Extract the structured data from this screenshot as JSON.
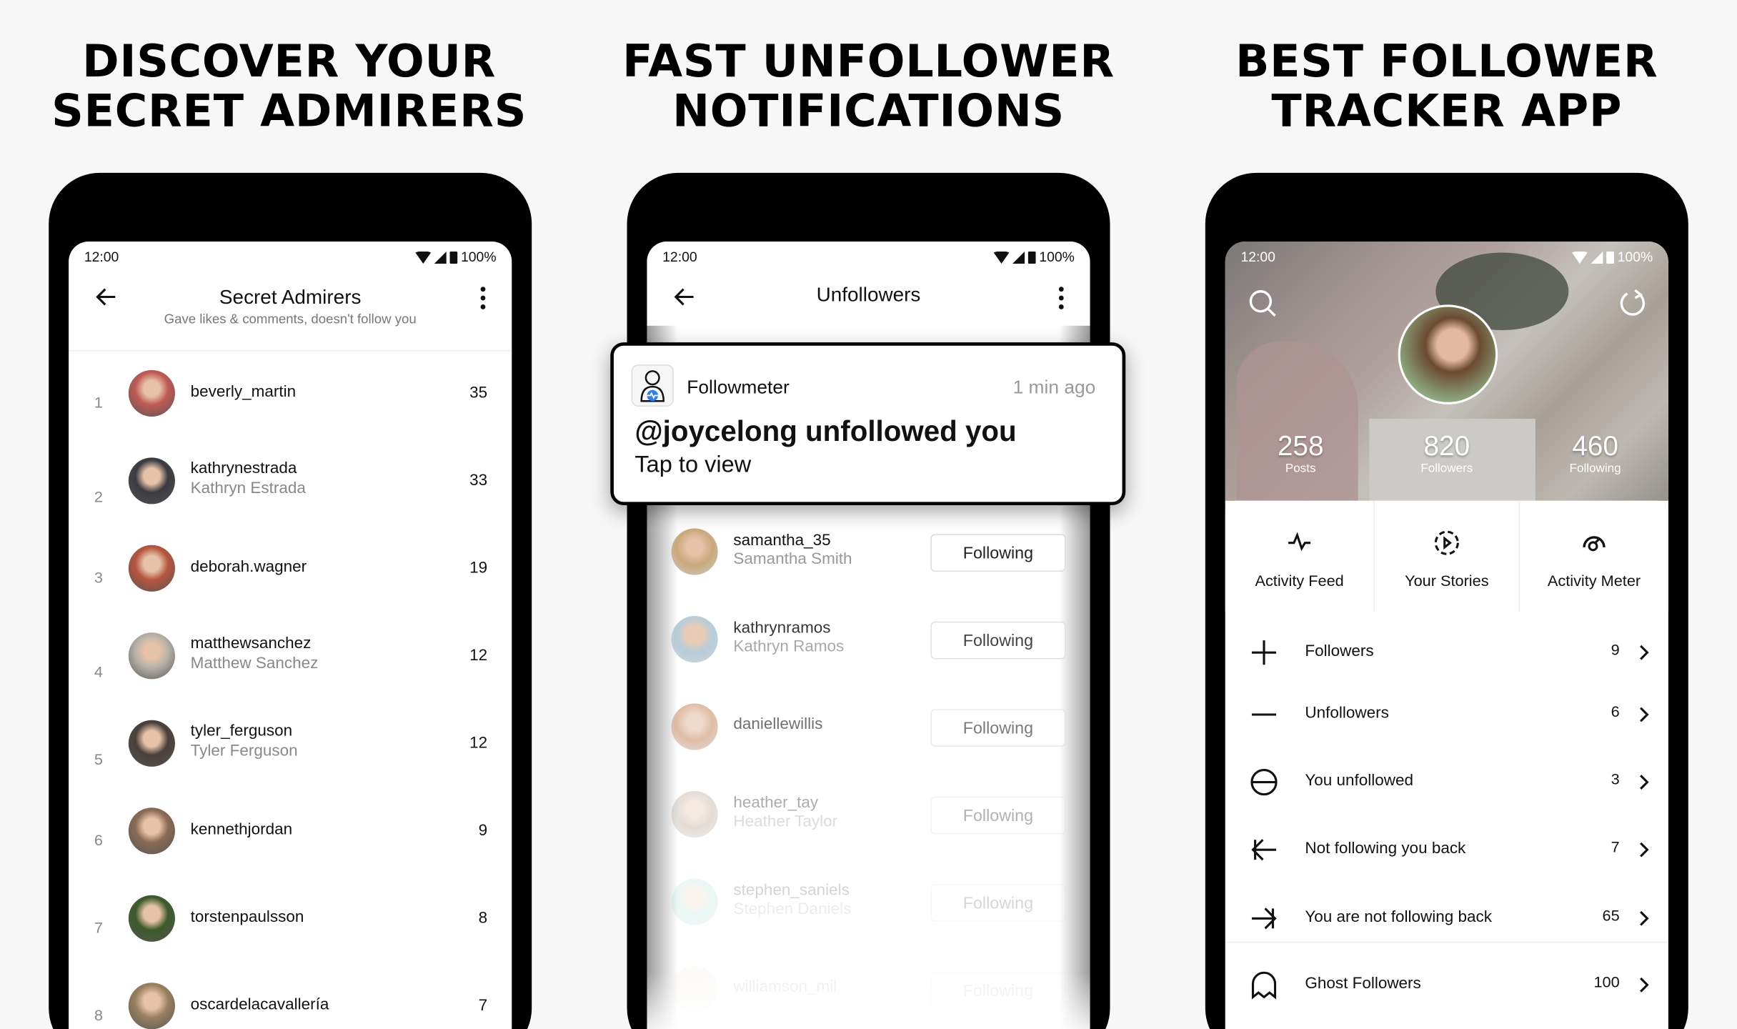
{
  "headlines": [
    [
      "DISCOVER YOUR",
      "SECRET ADMIRERS"
    ],
    [
      "FAST UNFOLLOWER",
      "NOTIFICATIONS"
    ],
    [
      "BEST FOLLOWER",
      "TRACKER APP"
    ]
  ],
  "status": {
    "time": "12:00",
    "battery": "100%"
  },
  "admirers": {
    "title": "Secret Admirers",
    "subtitle": "Gave likes & comments, doesn't follow you",
    "rows": [
      {
        "rank": "1",
        "username": "beverly_martin",
        "name": "",
        "count": "35",
        "color": "#c05a55"
      },
      {
        "rank": "2",
        "username": "kathrynestrada",
        "name": "Kathryn Estrada",
        "count": "33",
        "color": "#3a3a40"
      },
      {
        "rank": "3",
        "username": "deborah.wagner",
        "name": "",
        "count": "19",
        "color": "#b7553f"
      },
      {
        "rank": "4",
        "username": "matthewsanchez",
        "name": "Matthew Sanchez",
        "count": "12",
        "color": "#b8b2aa"
      },
      {
        "rank": "5",
        "username": "tyler_ferguson",
        "name": "Tyler Ferguson",
        "count": "12",
        "color": "#4a3f3a"
      },
      {
        "rank": "6",
        "username": "kennethjordan",
        "name": "",
        "count": "9",
        "color": "#8a6a55"
      },
      {
        "rank": "7",
        "username": "torstenpaulsson",
        "name": "",
        "count": "8",
        "color": "#3d5a2a"
      },
      {
        "rank": "8",
        "username": "oscardelacavallería",
        "name": "",
        "count": "7",
        "color": "#9a8060"
      }
    ]
  },
  "unfollowers": {
    "title": "Unfollowers",
    "notification": {
      "app": "Followmeter",
      "time": "1 min ago",
      "title": "@joycelong unfollowed you",
      "body": "Tap to view"
    },
    "button_label": "Following",
    "rows": [
      {
        "username": "samantha_35",
        "name": "Samantha Smith",
        "color": "#c9a87a"
      },
      {
        "username": "kathrynramos",
        "name": "Kathryn Ramos",
        "color": "#a9c4d4"
      },
      {
        "username": "daniellewillis",
        "name": "",
        "color": "#c9906a"
      },
      {
        "username": "heather_tay",
        "name": "Heather Taylor",
        "color": "#b09a8a"
      },
      {
        "username": "stephen_saniels",
        "name": "Stephen Daniels",
        "color": "#7fd6c4"
      },
      {
        "username": "williamson_mil",
        "name": "",
        "color": "#d8c8a0"
      }
    ]
  },
  "profile": {
    "stats": [
      {
        "value": "258",
        "label": "Posts"
      },
      {
        "value": "820",
        "label": "Followers"
      },
      {
        "value": "460",
        "label": "Following"
      }
    ],
    "cards": [
      {
        "label": "Activity Feed",
        "icon": "pulse-icon"
      },
      {
        "label": "Your Stories",
        "icon": "story-play-icon"
      },
      {
        "label": "Activity Meter",
        "icon": "gauge-icon"
      }
    ],
    "menu": [
      {
        "label": "Followers",
        "count": "9",
        "icon": "plus-icon"
      },
      {
        "label": "Unfollowers",
        "count": "6",
        "icon": "minus-icon"
      },
      {
        "label": "You unfollowed",
        "count": "3",
        "icon": "blocked-circle-icon"
      },
      {
        "label": "Not following you back",
        "count": "7",
        "icon": "arrow-in-icon"
      },
      {
        "label": "You are not following back",
        "count": "65",
        "icon": "arrow-out-icon"
      },
      {
        "label": "Ghost Followers",
        "count": "100",
        "icon": "ghost-icon"
      }
    ]
  },
  "colors": {
    "accent_blue": "#2f80ed",
    "text": "#111111",
    "muted": "#888888"
  }
}
